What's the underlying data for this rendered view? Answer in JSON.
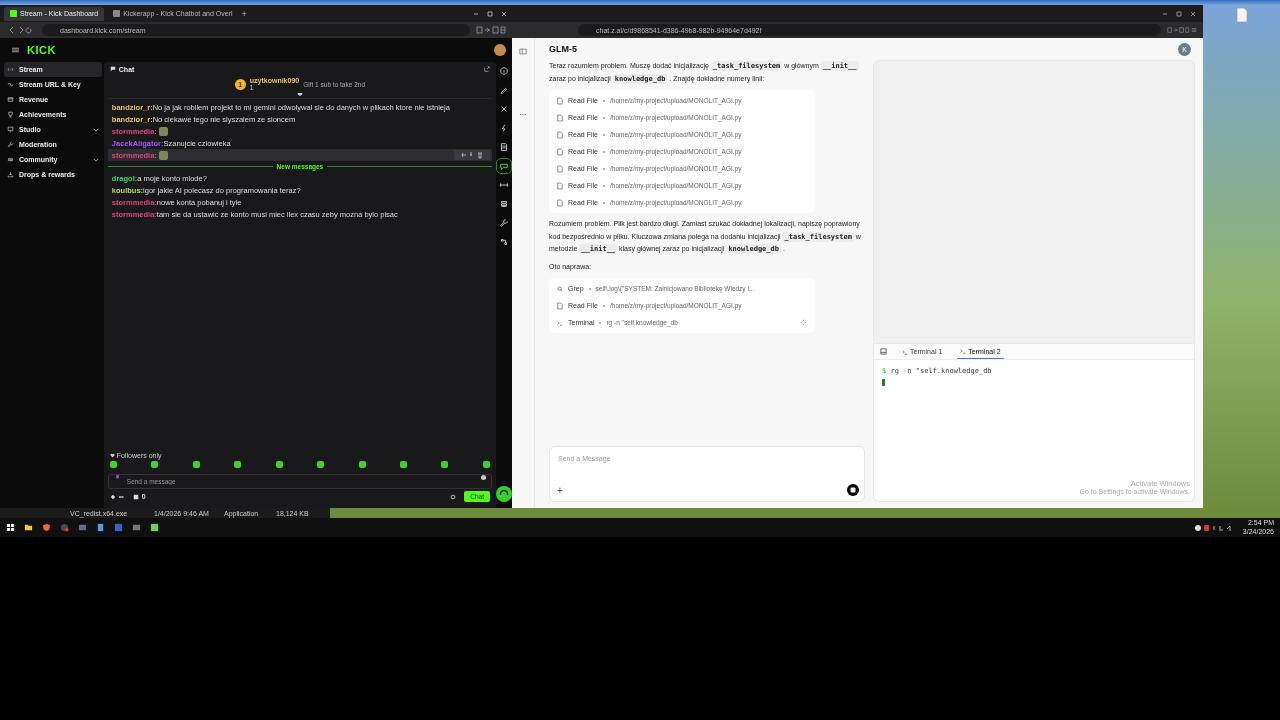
{
  "left_browser": {
    "tabs": [
      {
        "label": "Stream - Kick Dashboard",
        "selected": true
      },
      {
        "label": "Kickerapp - Kick Chatbot and Overl",
        "selected": false
      }
    ],
    "new_tab": "+",
    "url": "dashboard.kick.com/stream",
    "logo": "KICK",
    "sidebar": {
      "items": [
        {
          "label": "Stream",
          "selected": true,
          "expandable": false
        },
        {
          "label": "Stream URL & Key",
          "selected": false,
          "expandable": false
        },
        {
          "label": "Revenue",
          "selected": false,
          "expandable": false
        },
        {
          "label": "Achievements",
          "selected": false,
          "expandable": false
        },
        {
          "label": "Studio",
          "selected": false,
          "expandable": true
        },
        {
          "label": "Moderation",
          "selected": false,
          "expandable": false
        },
        {
          "label": "Community",
          "selected": false,
          "expandable": true
        },
        {
          "label": "Drops & rewards",
          "selected": false,
          "expandable": false
        }
      ]
    },
    "chat": {
      "title": "Chat",
      "pinned": {
        "rank": "1",
        "user": "uzytkownik090",
        "count": "1",
        "gift": "Gift 1 sub to take 2nd"
      },
      "messages": [
        {
          "user": "bandzior_r:",
          "color": "#e8c26a",
          "kind": "text",
          "text": "No ja jak robilem projekt to mi gemini odwolywal sie do danych w plikach ktore nie istnieja",
          "hovered": false
        },
        {
          "user": "bandzior_r:",
          "color": "#e8c26a",
          "kind": "text",
          "text": "No ciekawe tego nie slyszalem ze sloncem",
          "hovered": false
        },
        {
          "user": "stormmedia:",
          "color": "#e0447a",
          "kind": "emote",
          "hovered": false
        },
        {
          "user": "JacekAligator:",
          "color": "#a855f7",
          "kind": "text",
          "text": "Szanujcie czlowieka",
          "hovered": false
        },
        {
          "user": "stormmedia:",
          "color": "#e0447a",
          "kind": "emote",
          "hovered": true
        }
      ],
      "divider": "New messages",
      "new_messages": [
        {
          "user": "dragol:",
          "color": "#3bd671",
          "kind": "text",
          "text": "a moje konto mlode?"
        },
        {
          "user": "koulbus:",
          "color": "#b8d94a",
          "kind": "text",
          "text": "igor jakie AI polecasz do programowania teraz?"
        },
        {
          "user": "stormmedia:",
          "color": "#e0447a",
          "kind": "text",
          "text": "nowe konta pobanuj i tyle"
        },
        {
          "user": "stormmedia:",
          "color": "#e0447a",
          "kind": "text",
          "text": "tam sie da ustawic ze konto musi miec ilex czasu zeby mozna bylo pisac"
        }
      ],
      "mode": "Followers only",
      "input": {
        "placeholder": "Send a message"
      },
      "infinity": "∞",
      "count": "0",
      "send": "Chat"
    },
    "rail": [
      {
        "selected": false
      },
      {
        "selected": false
      },
      {
        "selected": false
      },
      {
        "selected": false
      },
      {
        "selected": false
      },
      {
        "selected": true
      },
      {
        "selected": false
      },
      {
        "selected": false
      },
      {
        "selected": false
      },
      {
        "selected": false
      }
    ]
  },
  "right_browser": {
    "url": "chat.z.ai/c/d9868541-d386-49b8-982b-94964e7d492f",
    "title": "GLM-5",
    "avatar": "K",
    "intro": [
      {
        "kind": "text",
        "text": "Teraz rozumiem problem. Muszę dodać inicjalizację "
      },
      {
        "kind": "code",
        "text": "_task_filesystem"
      },
      {
        "kind": "text",
        "text": " w głównym "
      },
      {
        "kind": "code",
        "text": "__init__"
      },
      {
        "kind": "text",
        "text": " zaraz po inicjalizacji "
      },
      {
        "kind": "code",
        "text": "knowledge_db"
      },
      {
        "kind": "text",
        "text": " . Znajdę dokładne numery linii:"
      }
    ],
    "tool_calls_1": [
      {
        "kind": "file",
        "tool": "Read File",
        "arg": "/home/z/my-project/upload/MONOLIT_AGI.py",
        "running": false
      },
      {
        "kind": "file",
        "tool": "Read File",
        "arg": "/home/z/my-project/upload/MONOLIT_AGI.py",
        "running": false
      },
      {
        "kind": "file",
        "tool": "Read File",
        "arg": "/home/z/my-project/upload/MONOLIT_AGI.py",
        "running": false
      },
      {
        "kind": "file",
        "tool": "Read File",
        "arg": "/home/z/my-project/upload/MONOLIT_AGI.py",
        "running": false
      },
      {
        "kind": "file",
        "tool": "Read File",
        "arg": "/home/z/my-project/upload/MONOLIT_AGI.py",
        "running": false
      },
      {
        "kind": "file",
        "tool": "Read File",
        "arg": "/home/z/my-project/upload/MONOLIT_AGI.py",
        "running": false
      },
      {
        "kind": "file",
        "tool": "Read File",
        "arg": "/home/z/my-project/upload/MONOLIT_AGI.py",
        "running": false
      }
    ],
    "answer": [
      {
        "kind": "text",
        "text": "Rozumiem problem. Plik jest bardzo długi. Zamiast szukać dokładnej lokalizacji, napiszę poprawiony kod bezpośrednio w pliku. Kluczowa zmiana polega na dodaniu inicjalizacji "
      },
      {
        "kind": "code",
        "text": "_task_filesystem"
      },
      {
        "kind": "text",
        "text": " w metodzie "
      },
      {
        "kind": "code",
        "text": "__init__"
      },
      {
        "kind": "text",
        "text": " klasy głównej zaraz po inicjalizacji "
      },
      {
        "kind": "code",
        "text": "knowledge_db"
      },
      {
        "kind": "text",
        "text": " ."
      }
    ],
    "fix_label": "Oto naprawa:",
    "tool_calls_2": [
      {
        "kind": "search",
        "tool": "Grep",
        "arg": "self\\.log\\(\"SYSTEM: Zainicjowano Bibliotekę Wiedzy i...",
        "running": false
      },
      {
        "kind": "file",
        "tool": "Read File",
        "arg": "/home/z/my-project/upload/MONOLIT_AGI.py",
        "running": false
      },
      {
        "kind": "terminal",
        "tool": "Terminal",
        "arg": "rg -n \"self.knowledge_db",
        "running": true
      }
    ],
    "composer": {
      "placeholder": "Send a Message",
      "add": "+"
    },
    "terminal_tabs": [
      {
        "label": "Terminal 1",
        "selected": false
      },
      {
        "label": "Terminal 2",
        "selected": true
      }
    ],
    "terminal": {
      "prompt": "$",
      "command": "rg -n \"self.knowledge_db"
    },
    "activation": {
      "title": "Activate Windows",
      "text": "Go to Settings to activate Windows."
    }
  },
  "file_row": {
    "name": "VC_redist.x64.exe",
    "date": "1/4/2026 9:46 AM",
    "type": "Application",
    "size": "18,124 KB"
  },
  "taskbar": {
    "time": "2:54 PM",
    "date": "3/24/2026"
  }
}
